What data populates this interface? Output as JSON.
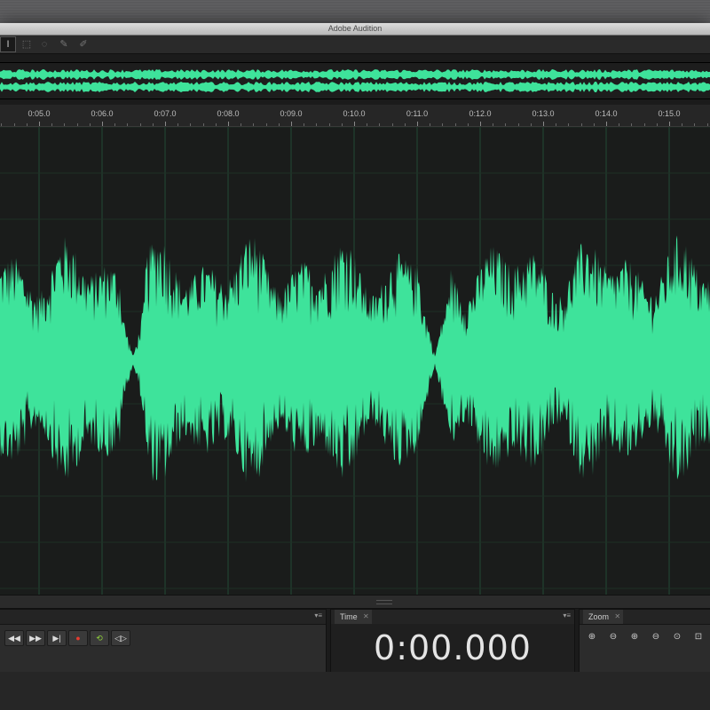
{
  "window": {
    "title": "Adobe Audition"
  },
  "toolbar": {
    "tools": [
      {
        "icon": "time-selection-icon",
        "glyph": "I"
      },
      {
        "icon": "marquee-select-icon",
        "glyph": "⬚"
      },
      {
        "icon": "lasso-select-icon",
        "glyph": "◌"
      },
      {
        "icon": "brush-select-icon",
        "glyph": "✎"
      },
      {
        "icon": "spot-healing-icon",
        "glyph": "✐"
      }
    ]
  },
  "ruler": {
    "labels": [
      "0:05.0",
      "0:06.0",
      "0:07.0",
      "0:08.0",
      "0:09.0",
      "0:10.0",
      "0:11.0",
      "0:12.0",
      "0:13.0",
      "0:14.0",
      "0:15.0"
    ]
  },
  "colors": {
    "waveform": "#3ee39b",
    "background": "#1a1c1b",
    "grid": "#234a34"
  },
  "transport": {
    "buttons": [
      {
        "icon": "rewind-icon",
        "glyph": "◀◀"
      },
      {
        "icon": "fast-forward-icon",
        "glyph": "▶▶"
      },
      {
        "icon": "skip-to-end-icon",
        "glyph": "▶|"
      },
      {
        "icon": "record-icon",
        "glyph": "●"
      },
      {
        "icon": "loop-icon",
        "glyph": "⟲"
      },
      {
        "icon": "skip-selection-icon",
        "glyph": "◁▷"
      }
    ]
  },
  "time_panel": {
    "tab_label": "Time",
    "timecode": "0:00.000"
  },
  "zoom_panel": {
    "tab_label": "Zoom",
    "buttons": [
      {
        "icon": "zoom-in-amplitude-icon",
        "glyph": "⊕"
      },
      {
        "icon": "zoom-out-amplitude-icon",
        "glyph": "⊖"
      },
      {
        "icon": "zoom-in-time-icon",
        "glyph": "⊕"
      },
      {
        "icon": "zoom-out-time-icon",
        "glyph": "⊖"
      },
      {
        "icon": "zoom-selection-icon",
        "glyph": "⊙"
      },
      {
        "icon": "zoom-full-icon",
        "glyph": "⊡"
      }
    ]
  }
}
